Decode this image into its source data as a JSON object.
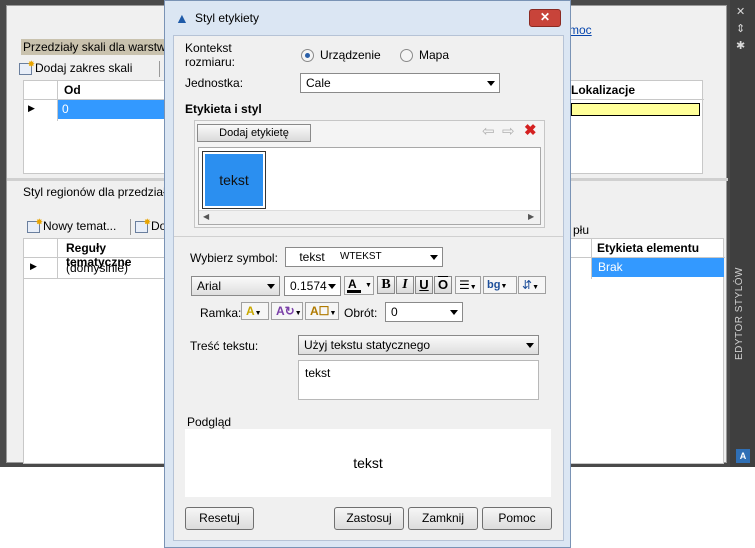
{
  "palette": {
    "side_title": "EDYTOR STYLÓW",
    "help_link": "moc",
    "scale_section": {
      "title": "Przedziały skali dla warstwy",
      "add_button": "Dodaj zakres skali",
      "columns": [
        "Od",
        "Lokalizacje"
      ],
      "rows": [
        {
          "from": "0"
        }
      ]
    },
    "region_section": {
      "title": "Styl regionów dla przedziału",
      "new_theme_button": "Nowy temat...",
      "second_button_partial": "Do",
      "partial_text": "płu",
      "columns": [
        "Reguły tematyczne",
        "Etykieta elementu"
      ],
      "rows": [
        {
          "rule": "(domyślnie)",
          "label": "Brak"
        }
      ]
    }
  },
  "dialog": {
    "title": "Styl etykiety",
    "context": {
      "label": "Kontekst rozmiaru:",
      "options": [
        "Urządzenie",
        "Mapa"
      ],
      "selected": "Urządzenie"
    },
    "unit": {
      "label": "Jednostka:",
      "value": "Cale"
    },
    "label_style_section": "Etykieta i styl",
    "add_label_button": "Dodaj etykietę",
    "label_preview_text": "tekst",
    "symbol": {
      "label": "Wybierz symbol:",
      "preview": "tekst",
      "value": "WTEKST"
    },
    "font": {
      "family": "Arial",
      "size": "0.1574"
    },
    "format_buttons": {
      "bold": "B",
      "italic": "I",
      "underline": "U",
      "overline": "O",
      "background": "bg"
    },
    "frame_label": "Ramka:",
    "rotation": {
      "label": "Obrót:",
      "value": "0"
    },
    "text_content": {
      "label": "Treść tekstu:",
      "mode": "Użyj tekstu statycznego",
      "value": "tekst"
    },
    "preview": {
      "label": "Podgląd",
      "text": "tekst"
    },
    "buttons": {
      "reset": "Resetuj",
      "apply": "Zastosuj",
      "close": "Zamknij",
      "help": "Pomoc"
    }
  },
  "colors": {
    "selection_blue": "#3399ff",
    "highlight_yellow": "#ffff99",
    "label_preview_bg": "#2b8ff0"
  }
}
